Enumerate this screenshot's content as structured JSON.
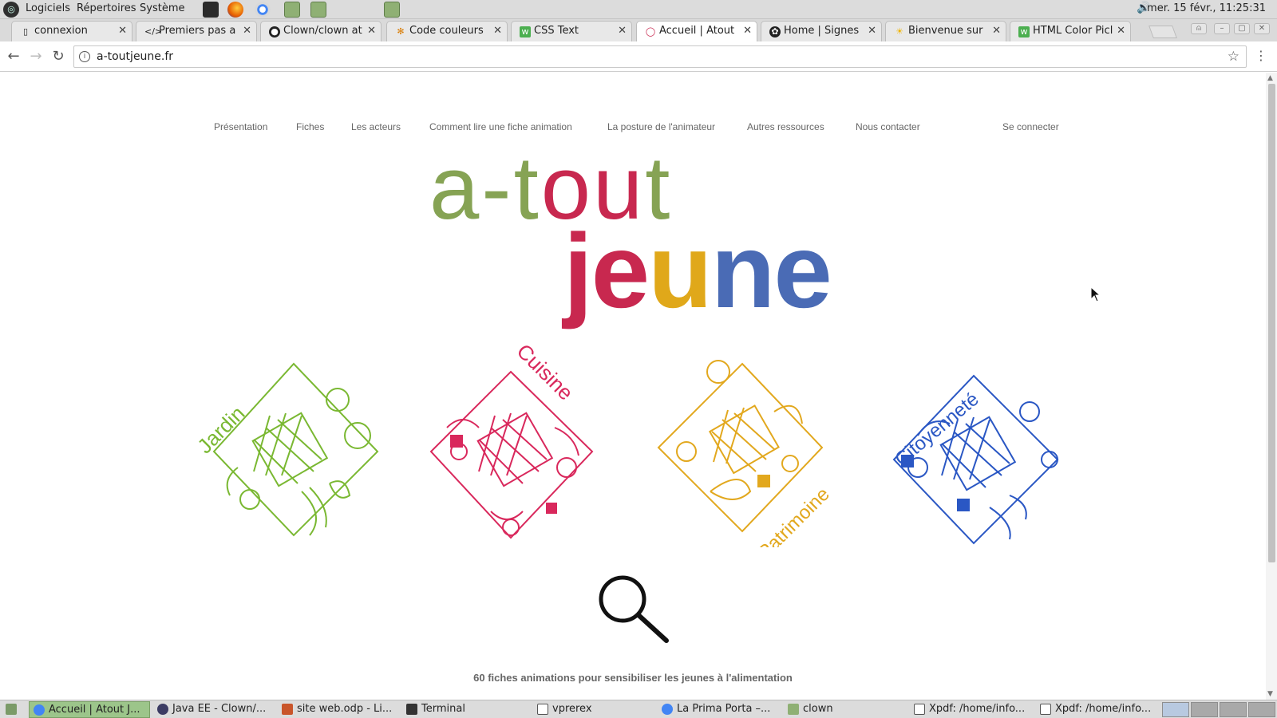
{
  "system": {
    "menus": [
      "Logiciels",
      "Répertoires",
      "Système"
    ],
    "clock": "mer. 15 févr., 11:25:31"
  },
  "browser": {
    "tabs": [
      {
        "label": "connexion",
        "icon": "page-icon"
      },
      {
        "label": "Premiers pas a",
        "icon": "code-icon"
      },
      {
        "label": "Clown/clown at",
        "icon": "github-icon"
      },
      {
        "label": "Code couleurs",
        "icon": "color-icon"
      },
      {
        "label": "CSS Text",
        "icon": "w3-icon"
      },
      {
        "label": "Accueil | Atout",
        "icon": "atout-icon"
      },
      {
        "label": "Home | Signes",
        "icon": "signes-icon"
      },
      {
        "label": "Bienvenue sur",
        "icon": "sun-icon"
      },
      {
        "label": "HTML Color Picl",
        "icon": "w3-icon"
      }
    ],
    "active_tab": 5,
    "url": "a-toutjeune.fr"
  },
  "site": {
    "nav": [
      "Présentation",
      "Fiches",
      "Les acteurs",
      "Comment lire une fiche animation",
      "La posture de l'animateur",
      "Autres ressources",
      "Nous contacter"
    ],
    "login": "Se connecter",
    "logo_top": "a-tout",
    "logo_bottom": "jeune",
    "themes": [
      {
        "label": "Jardin",
        "color": "#7ab832"
      },
      {
        "label": "Cuisine",
        "color": "#d9285c"
      },
      {
        "label": "Patrimoine",
        "color": "#e2a81e"
      },
      {
        "label": "Citoyenneté",
        "color": "#2a57c4"
      }
    ],
    "tagline": "60 fiches animations pour sensibiliser les jeunes à l'alimentation"
  },
  "taskbar": {
    "items": [
      {
        "label": "Accueil | Atout J...",
        "active": true
      },
      {
        "label": "Java EE - Clown/..."
      },
      {
        "label": "site web.odp - Li..."
      },
      {
        "label": "Terminal"
      },
      {
        "label": "vprerex"
      },
      {
        "label": "La Prima Porta –..."
      },
      {
        "label": "clown"
      },
      {
        "label": "Xpdf: /home/info..."
      },
      {
        "label": "Xpdf: /home/info..."
      }
    ]
  },
  "colors": {
    "green": "#7a9a4e",
    "crimson": "#c8284f",
    "yellow": "#e0a81a",
    "blue": "#4a6bb5"
  }
}
